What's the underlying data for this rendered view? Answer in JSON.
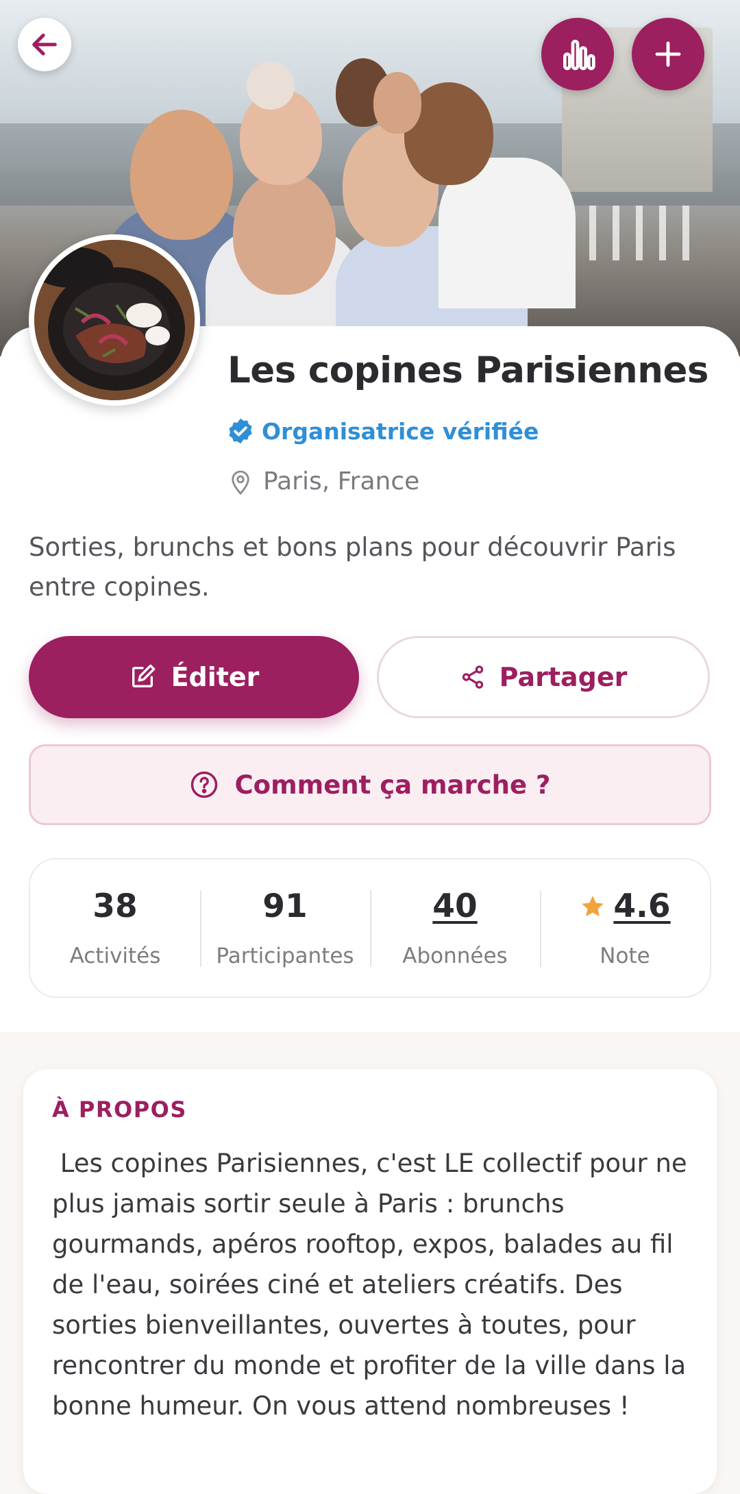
{
  "header": {
    "back_icon": "arrow-left-icon",
    "stats_icon": "bar-chart-icon",
    "add_icon": "plus-icon"
  },
  "profile": {
    "name": "Les copines Parisiennes",
    "verified_label": "Organisatrice vérifiée",
    "location": "Paris, France",
    "tagline": "Sorties, brunchs et bons plans pour découvrir Paris entre copines."
  },
  "actions": {
    "edit_label": "Éditer",
    "share_label": "Partager",
    "how_it_works_label": "Comment ça marche ?"
  },
  "stats": [
    {
      "value": "38",
      "label": "Activités"
    },
    {
      "value": "91",
      "label": "Participantes"
    },
    {
      "value": "40",
      "label": "Abonnées"
    },
    {
      "value": "4.6",
      "label": "Note"
    }
  ],
  "about": {
    "heading": "À PROPOS",
    "text": " Les copines Parisiennes, c'est LE collectif pour ne plus jamais sortir seule à Paris : brunchs gourmands, apéros rooftop, expos, balades au fil de l'eau, soirées ciné et ateliers créatifs. Des sorties bienveillantes, ouvertes à toutes, pour rencontrer du monde et profiter de la ville dans la bonne humeur. On vous attend nombreuses !"
  },
  "colors": {
    "brand": "#9c1f5f",
    "verified": "#2f8fd6",
    "star": "#f2a33a"
  }
}
